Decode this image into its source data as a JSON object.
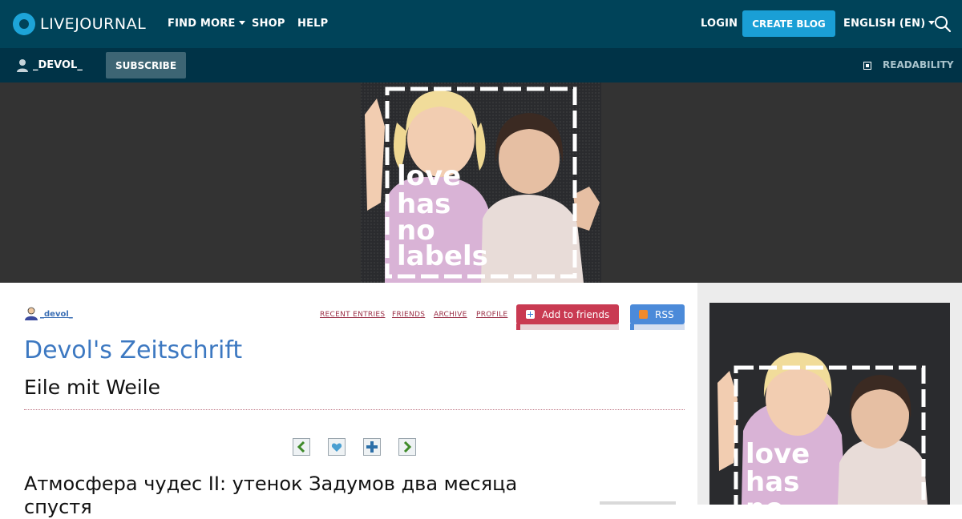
{
  "topbar": {
    "logo_text": "LIVEJOURNAL",
    "nav": [
      "FIND MORE",
      "SHOP",
      "HELP"
    ],
    "login": "LOGIN",
    "create_blog": "CREATE BLOG",
    "language": "ENGLISH (EN)"
  },
  "subbar": {
    "username": "_DEVOL_",
    "subscribe": "SUBSCRIBE",
    "readability": "READABILITY"
  },
  "banner": {
    "ad_text": [
      "love",
      "has",
      "no",
      "labels"
    ]
  },
  "journal": {
    "username": "_devol_",
    "links": [
      "RECENT ENTRIES",
      "FRIENDS",
      "ARCHIVE",
      "PROFILE"
    ],
    "add_to_friends": "Add to friends",
    "rss": "RSS",
    "title": "Devol's Zeitschrift",
    "subtitle": "Eile mit Weile"
  },
  "entry": {
    "title": "Атмосфера чудес II: утенок Задумов два месяца спустя"
  },
  "colors": {
    "topbar": "#004359",
    "subbar": "#003347",
    "accent": "#1a9fd6",
    "add_friends": "#c93a52",
    "rss": "#4b8ad9",
    "title": "#3c78c1"
  }
}
